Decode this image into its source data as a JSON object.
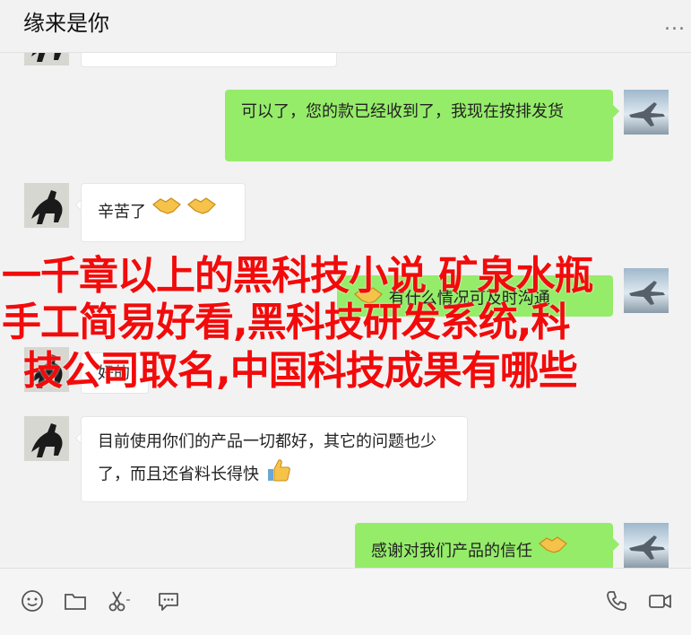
{
  "header": {
    "title": "缘来是你",
    "more_label": "..."
  },
  "messages": [
    {
      "side": "right",
      "text": "可以了，您的款已经收到了，我现在按排发货"
    },
    {
      "side": "left",
      "text": "辛苦了"
    },
    {
      "side": "right",
      "text": "有什么情况可及时沟通"
    },
    {
      "side": "left",
      "text": "好的"
    },
    {
      "side": "left",
      "text": "目前使用你们的产品一切都好，其它的问题也少了，而且还省料长得快"
    },
    {
      "side": "right",
      "text": "感谢对我们产品的信任"
    }
  ],
  "overlay": {
    "line1": "一千章以上的黑科技小说 矿泉水瓶",
    "line2": "手工简易好看,黑科技研发系统,科",
    "line3": "技公司取名,中国科技成果有哪些"
  },
  "toolbar": {
    "icons": [
      "emoji-icon",
      "folder-icon",
      "scissors-icon",
      "chat-bubble-icon",
      "phone-icon",
      "video-icon"
    ]
  },
  "colors": {
    "background": "#f2f2f2",
    "bubble_green": "#95ec69",
    "bubble_white": "#ffffff",
    "overlay_red": "#f20b0b"
  }
}
